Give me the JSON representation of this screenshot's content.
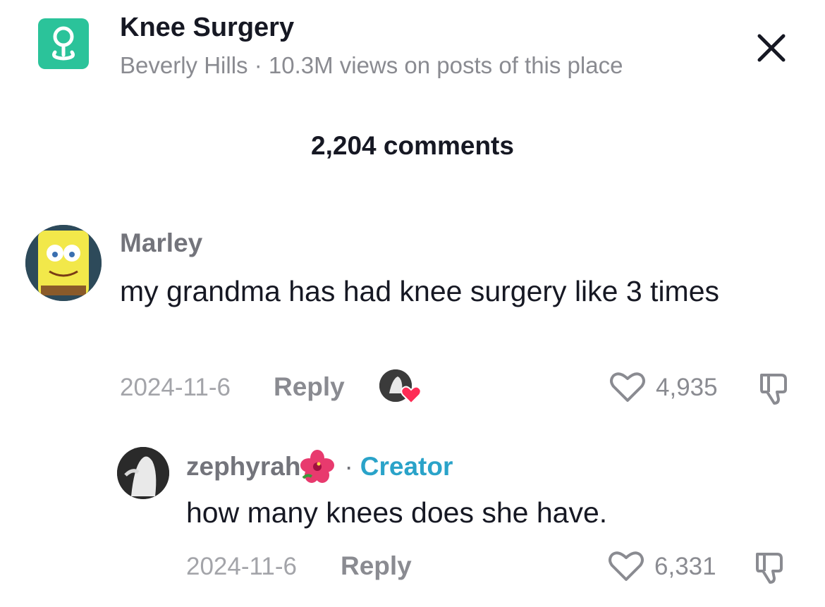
{
  "header": {
    "place_icon": "map-pin-icon",
    "title": "Knee Surgery",
    "subtitle": "Beverly Hills · 10.3M views on posts of this place",
    "close_icon": "close-icon"
  },
  "comments_count": "2,204 comments",
  "comments": [
    {
      "username": "Marley",
      "text": "my grandma has had knee surgery like 3 times",
      "date": "2024-11-6",
      "reply_label": "Reply",
      "likes": "4,935",
      "liked_by_creator": true,
      "reply": {
        "username": "zephyrah",
        "emoji": "🌺",
        "separator": "·",
        "badge": "Creator",
        "text": "how many knees does she have.",
        "date": "2024-11-6",
        "reply_label": "Reply",
        "likes": "6,331"
      }
    }
  ],
  "colors": {
    "accent_place": "#2bc39a",
    "creator_badge": "#2aa3c9",
    "heart": "#fe2c55"
  }
}
